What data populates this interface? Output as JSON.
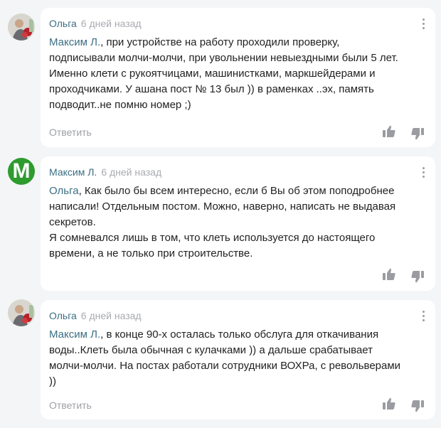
{
  "comments": [
    {
      "author": "Ольга",
      "time": "6 дней назад",
      "avatar": "photo-avatar",
      "mention": "Максим Л.",
      "text_first": ", при устройстве на работу проходили проверку,",
      "lines": [
        "подписывали молчи-молчи, при увольнении невыездными были 5 лет.",
        "Именно клети с рукоятчицами, машинистками, маркшейдерами и",
        "проходчиками. У ашана пост № 13 был )) в раменках ..эх, память",
        "подводит..не помню номер ;)"
      ],
      "reply": "Ответить"
    },
    {
      "author": "Максим Л.",
      "time": "6 дней назад",
      "avatar_letter": "М",
      "mention": "Ольга",
      "text_first": ", Как было бы всем интересно, если б Вы об этом поподробнее",
      "lines": [
        "написали! Отдельным постом. Можно, наверно, написать не выдавая",
        "секретов.",
        "Я сомневался лишь в том, что клеть используется до настоящего",
        "времени, а не только при строительстве."
      ]
    },
    {
      "author": "Ольга",
      "time": "6 дней назад",
      "avatar": "photo-avatar",
      "mention": "Максим Л.",
      "text_first": ", в конце 90-х осталась только обслуга для откачивания",
      "lines": [
        "воды..Клеть была обычная с кулачками )) а дальше срабатывает",
        "молчи-молчи. На постах работали сотрудники ВОХРа, с револьверами",
        "))"
      ],
      "reply": "Ответить"
    }
  ],
  "icons": {
    "like": "thumbs-up-icon",
    "dislike": "thumbs-down-icon",
    "more": "more-vertical-icon"
  },
  "colors": {
    "accent": "#3c6f84",
    "muted": "#a9abb0",
    "avatar_green": "#2e9b2e"
  }
}
